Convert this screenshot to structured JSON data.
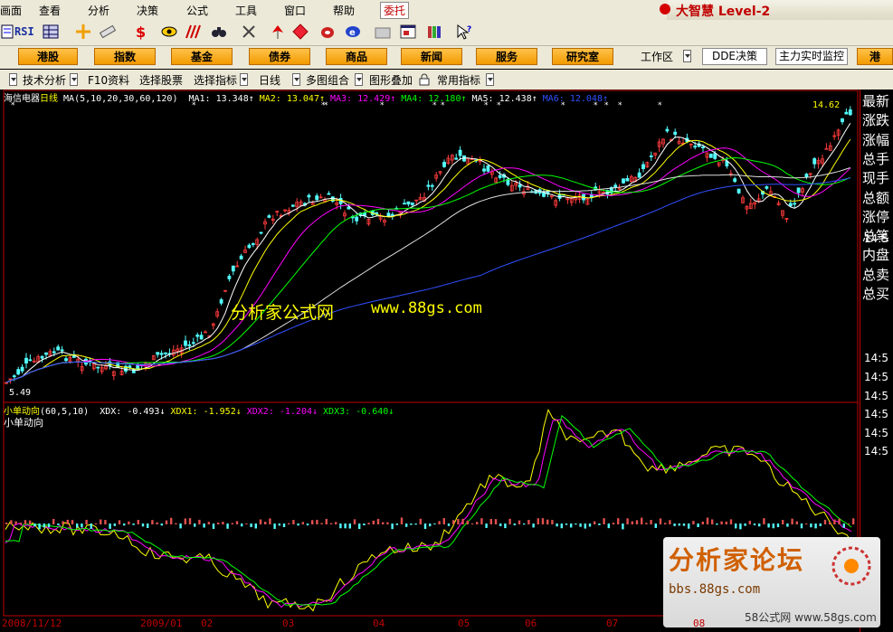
{
  "menu": {
    "items": [
      "画面",
      "查看",
      "分析",
      "决策",
      "公式",
      "工具",
      "窗口",
      "帮助"
    ],
    "trade": "委托",
    "brand": "大智慧 Level-2"
  },
  "toolbar": {
    "rsi": "RSI"
  },
  "nav": {
    "buttons": [
      "港股",
      "指数",
      "基金",
      "债券",
      "商品",
      "新闻",
      "服务",
      "研究室"
    ],
    "workspace": "工作区",
    "dde": "DDE决策",
    "monitor": "主力实时监控",
    "last": "港"
  },
  "analysis_bar": {
    "items": [
      "技术分析",
      "F10资料",
      "选择股票",
      "选择指标",
      "日线",
      "多图组合",
      "图形叠加",
      "常用指标"
    ]
  },
  "main_chart": {
    "stock": "海信电器",
    "period": "日线",
    "ma_label": "MA",
    "ma_params": "(5,10,20,30,60,120)",
    "ma_values": [
      {
        "name": "MA1:",
        "value": "13.348",
        "arrow": "↑",
        "color": "#ffffff"
      },
      {
        "name": "MA2:",
        "value": "13.047",
        "arrow": "↑",
        "color": "#ffff00"
      },
      {
        "name": "MA3:",
        "value": "12.429",
        "arrow": "↑",
        "color": "#ff00ff"
      },
      {
        "name": "MA4:",
        "value": "12.180",
        "arrow": "↑",
        "color": "#00ff00"
      },
      {
        "name": "MA5:",
        "value": "12.438",
        "arrow": "↑",
        "color": "#ffffff"
      },
      {
        "name": "MA6:",
        "value": "12.048",
        "arrow": "↑",
        "color": "#3050ff"
      }
    ],
    "high_label": "14.62",
    "low_label": "5.49",
    "watermark_cn": "分析家公式网",
    "watermark_url": "www.88gs.com"
  },
  "sub_chart": {
    "name": "小单动向",
    "params": "(60,5,10)",
    "values": [
      {
        "name": "XDX:",
        "value": "-0.493",
        "arrow": "↓",
        "color": "#ffffff"
      },
      {
        "name": "XDX1:",
        "value": "-1.952",
        "arrow": "↓",
        "color": "#ffff00"
      },
      {
        "name": "XDX2:",
        "value": "-1.204",
        "arrow": "↓",
        "color": "#ff00ff"
      },
      {
        "name": "XDX3:",
        "value": "-0.640",
        "arrow": "↓",
        "color": "#00ff00"
      }
    ],
    "caption": "小单动向"
  },
  "side_panel": {
    "labels": [
      "最新",
      "涨跌",
      "涨幅",
      "总手",
      "现手",
      "总额",
      "涨停",
      "总笔",
      "内盘",
      "总卖",
      "总买"
    ],
    "times": [
      "14:5",
      "14:5",
      "14:5",
      "14:5",
      "14:5",
      "14:5",
      "14:5"
    ]
  },
  "dates": [
    "2008/11/12",
    "2009/01",
    "02",
    "03",
    "04",
    "05",
    "06",
    "07",
    "08"
  ],
  "forum": {
    "title": "分析家论坛",
    "url": "bbs.88gs.com",
    "footer": "58公式网 www.58gs.com"
  },
  "colors": {
    "up": "#ff3b3b",
    "down": "#54ffff",
    "frame": "#c00000",
    "menubar": "#ece9d8"
  }
}
